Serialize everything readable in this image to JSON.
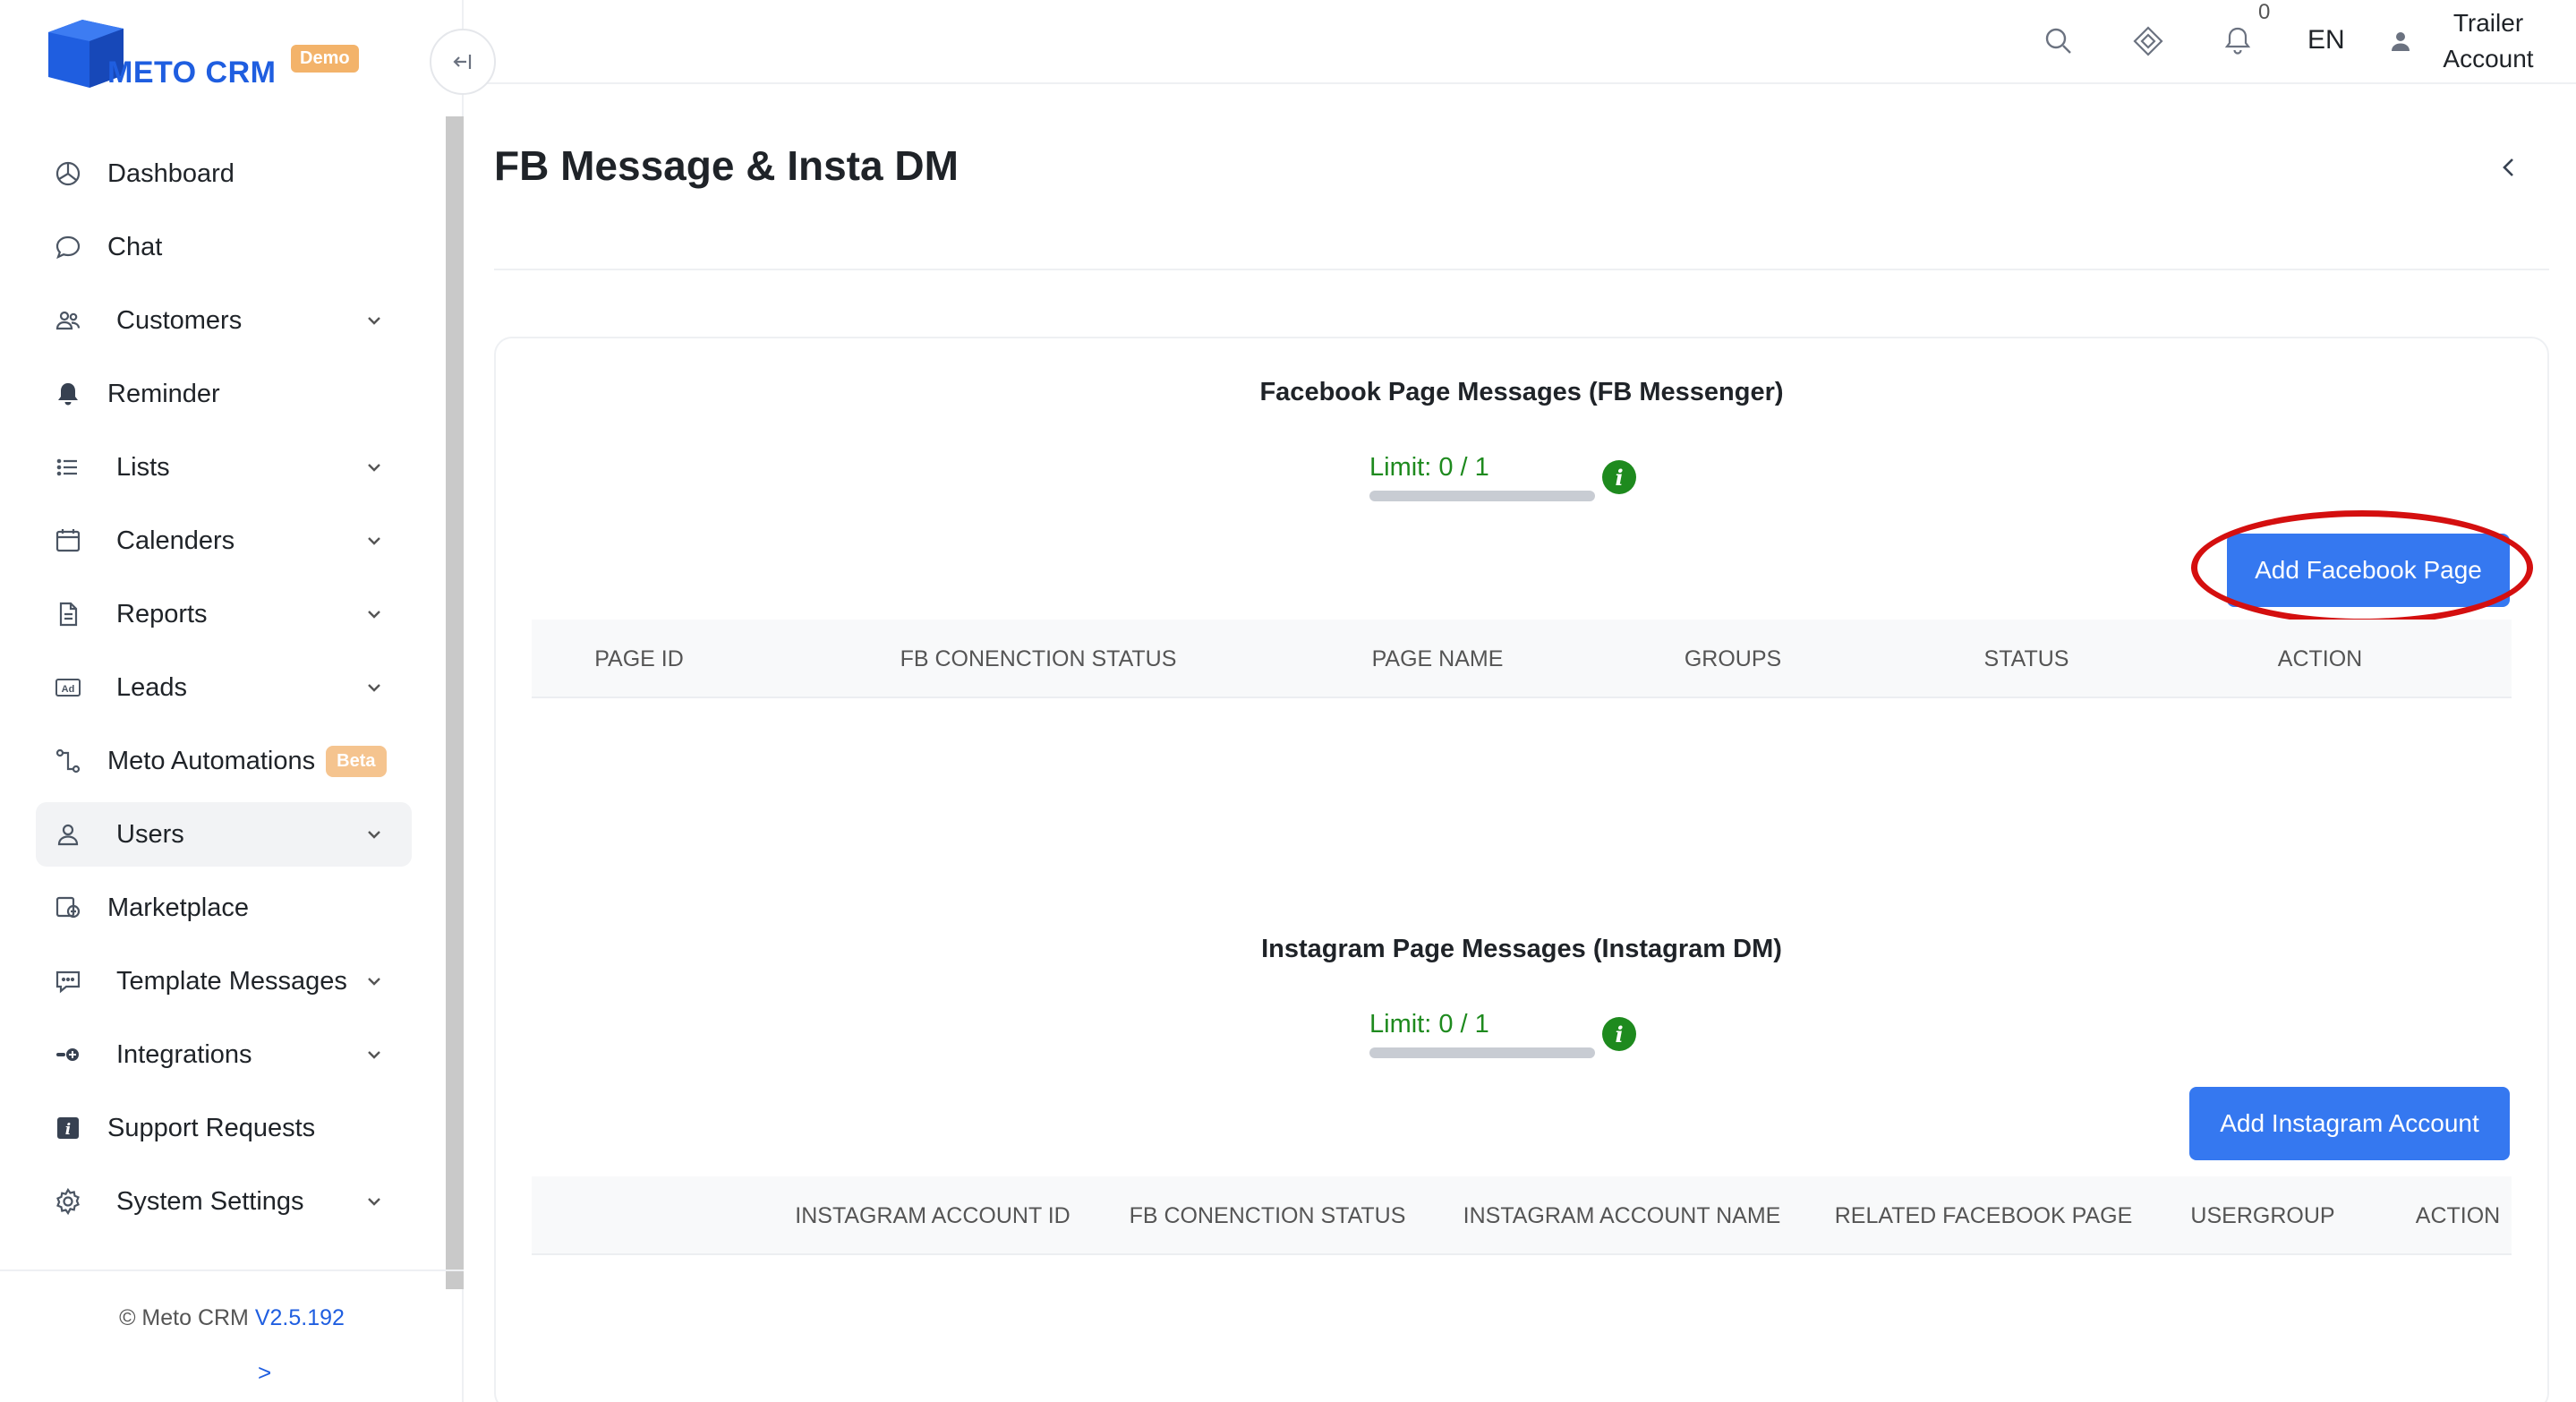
{
  "brand": {
    "name": "METO CRM",
    "badge": "Demo",
    "primary_color": "#1f5ee0"
  },
  "sidebar": {
    "collapse_icon": "collapse-left-icon",
    "items": [
      {
        "label": "Dashboard",
        "icon": "dashboard-icon",
        "expandable": false
      },
      {
        "label": "Chat",
        "icon": "chat-bubble-icon",
        "expandable": false
      },
      {
        "label": "Customers",
        "icon": "customers-icon",
        "expandable": true
      },
      {
        "label": "Reminder",
        "icon": "bell-icon",
        "expandable": false
      },
      {
        "label": "Lists",
        "icon": "list-icon",
        "expandable": true
      },
      {
        "label": "Calenders",
        "icon": "calendar-icon",
        "expandable": true
      },
      {
        "label": "Reports",
        "icon": "report-icon",
        "expandable": true
      },
      {
        "label": "Leads",
        "icon": "ad-icon",
        "expandable": true
      },
      {
        "label": "Meto Automations",
        "icon": "automation-icon",
        "expandable": false,
        "badge": "Beta"
      },
      {
        "label": "Users",
        "icon": "user-icon",
        "expandable": true,
        "active": true
      },
      {
        "label": "Marketplace",
        "icon": "marketplace-icon",
        "expandable": false
      },
      {
        "label": "Template Messages",
        "icon": "template-message-icon",
        "expandable": true
      },
      {
        "label": "Integrations",
        "icon": "integrations-icon",
        "expandable": true
      },
      {
        "label": "Support Requests",
        "icon": "support-icon",
        "expandable": false
      },
      {
        "label": "System Settings",
        "icon": "gear-icon",
        "expandable": true
      }
    ],
    "footer": {
      "copyright": "© Meto CRM",
      "version": "V2.5.192",
      "more": ">"
    }
  },
  "topbar": {
    "notification_count": "0",
    "language": "EN",
    "user_line1": "Trailer",
    "user_line2": "Account"
  },
  "page": {
    "title": "FB Message & Insta DM",
    "facebook": {
      "title": "Facebook Page Messages (FB Messenger)",
      "limit_text": "Limit: 0 / 1",
      "limit_fraction": 0,
      "add_button": "Add Facebook Page",
      "columns": [
        "PAGE ID",
        "FB CONENCTION STATUS",
        "PAGE NAME",
        "GROUPS",
        "STATUS",
        "ACTION"
      ]
    },
    "instagram": {
      "title": "Instagram Page Messages (Instagram DM)",
      "limit_text": "Limit: 0 / 1",
      "limit_fraction": 0,
      "add_button": "Add Instagram Account",
      "columns": [
        "INSTAGRAM ACCOUNT ID",
        "FB CONENCTION STATUS",
        "INSTAGRAM ACCOUNT NAME",
        "RELATED FACEBOOK PAGE",
        "USERGROUP",
        "ACTION"
      ]
    },
    "colors": {
      "button": "#3578f0",
      "limit": "#1e8a1e",
      "highlight": "#d40f0f"
    }
  }
}
